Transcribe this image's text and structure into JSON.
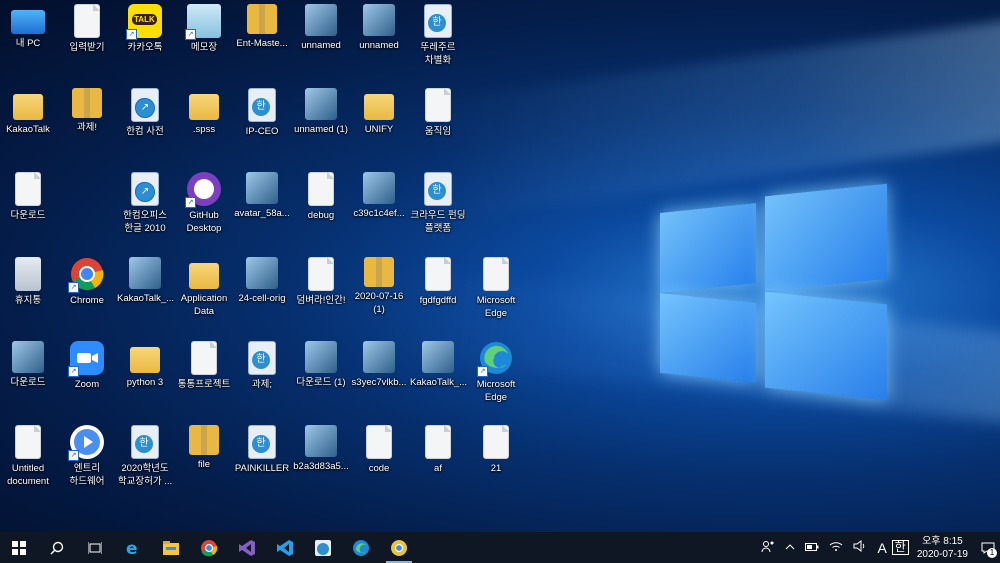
{
  "desktop": {
    "icons": [
      {
        "label": "내 PC",
        "icon": "pc-icon"
      },
      {
        "label": "입력받기",
        "icon": "file-icon"
      },
      {
        "label": "카카오톡",
        "icon": "kakaotalk-icon",
        "badge": "TALK"
      },
      {
        "label": "메모장",
        "icon": "notepad-icon"
      },
      {
        "label": "Ent-Maste...",
        "icon": "zip-icon"
      },
      {
        "label": "unnamed",
        "icon": "image-icon"
      },
      {
        "label": "unnamed",
        "icon": "image-icon"
      },
      {
        "label": "뚜레주르 차별화",
        "icon": "hwp-icon",
        "glyph": "한"
      },
      {
        "label": "KakaoTalk",
        "icon": "folder-icon"
      },
      {
        "label": "과제!",
        "icon": "zip-icon"
      },
      {
        "label": "한컴 사전",
        "icon": "hancom-dict-icon",
        "glyph": "D"
      },
      {
        "label": ".spss",
        "icon": "folder-icon"
      },
      {
        "label": "IP-CEO",
        "icon": "hwp-icon",
        "glyph": "한"
      },
      {
        "label": "unnamed (1)",
        "icon": "image-icon"
      },
      {
        "label": "UNIFY",
        "icon": "folder-icon"
      },
      {
        "label": "움직임",
        "icon": "file-icon"
      },
      {
        "label": "다운로드",
        "icon": "file-icon",
        "glyph": "±"
      },
      {
        "label": "한컴오피스 한글 2010",
        "icon": "hancom-office-icon",
        "glyph": "한"
      },
      {
        "label": "GitHub Desktop",
        "icon": "github-icon"
      },
      {
        "label": "avatar_58a...",
        "icon": "image-icon"
      },
      {
        "label": "debug",
        "icon": "file-icon"
      },
      {
        "label": "c39c1c4ef...",
        "icon": "image-icon"
      },
      {
        "label": "크라우드 펀딩 플랫폼",
        "icon": "hwp-icon",
        "glyph": "한"
      },
      {
        "label": "휴지통",
        "icon": "recycle-bin-icon"
      },
      {
        "label": "Chrome",
        "icon": "chrome-icon"
      },
      {
        "label": "KakaoTalk_...",
        "icon": "image-icon"
      },
      {
        "label": "Application Data",
        "icon": "folder-icon"
      },
      {
        "label": "24-cell-orig",
        "icon": "image-icon"
      },
      {
        "label": "덤벼라!인간!",
        "icon": "settings-file-icon"
      },
      {
        "label": "2020-07-16 (1)",
        "icon": "zip-icon"
      },
      {
        "label": "fgdfgdffd",
        "icon": "file-icon"
      },
      {
        "label": "Microsoft Edge",
        "icon": "file-icon"
      },
      {
        "label": "다운로드",
        "icon": "image-icon"
      },
      {
        "label": "Zoom",
        "icon": "zoom-icon"
      },
      {
        "label": "python 3",
        "icon": "folder-icon"
      },
      {
        "label": "통통프로젝트",
        "icon": "file-icon"
      },
      {
        "label": "과제;",
        "icon": "hwp-icon",
        "glyph": "한"
      },
      {
        "label": "다운로드 (1)",
        "icon": "image-icon"
      },
      {
        "label": "s3yec7vlkb...",
        "icon": "image-icon"
      },
      {
        "label": "KakaoTalk_...",
        "icon": "image-icon"
      },
      {
        "label": "Microsoft Edge",
        "icon": "edge-icon"
      },
      {
        "label": "Untitled document",
        "icon": "word-doc-icon"
      },
      {
        "label": "엔트리 하드웨어",
        "icon": "entry-icon"
      },
      {
        "label": "2020학년도 학교장허가 ...",
        "icon": "hwp-icon",
        "glyph": "한"
      },
      {
        "label": "file",
        "icon": "zip-icon"
      },
      {
        "label": "PAINKILLER",
        "icon": "hwp-icon",
        "glyph": "한"
      },
      {
        "label": "b2a3d83a5...",
        "icon": "image-icon"
      },
      {
        "label": "code",
        "icon": "file-icon"
      },
      {
        "label": "af",
        "icon": "file-icon"
      },
      {
        "label": "21",
        "icon": "file-icon"
      }
    ]
  },
  "taskbar": {
    "start": "windows-start-icon",
    "search": "search-icon",
    "taskview": "task-view-icon",
    "apps": [
      "internet-explorer-icon",
      "file-explorer-icon",
      "chrome-icon",
      "visual-studio-icon",
      "vscode-icon",
      "hancom-icon",
      "edge-icon",
      "chrome-canary-icon"
    ],
    "tray": {
      "ime_mode": "A",
      "ime_lang": "한",
      "time": "오후 8:15",
      "date": "2020-07-19",
      "notification_count": "1"
    }
  }
}
